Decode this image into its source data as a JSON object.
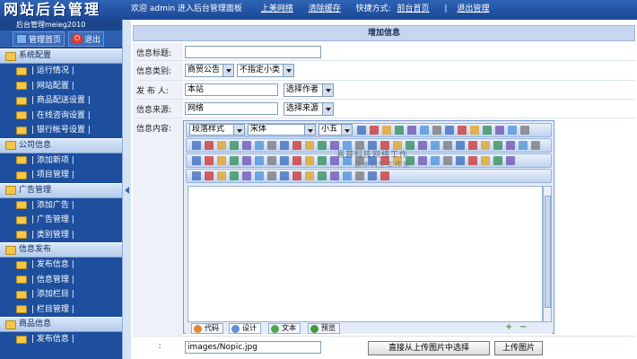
{
  "header": {
    "logo": "网站后台管理",
    "subtitle": "后台管理meieg2010",
    "welcome": "欢迎 admin 进入后台管理面板",
    "link_site": "上美网络",
    "link_cache": "清除缓存",
    "shortcut_prefix": "快捷方式:",
    "link_home": "前台首页",
    "sep": "|",
    "link_logout": "退出管理"
  },
  "sidebar": {
    "home_label": "管理首页",
    "exit_label": "退出",
    "groups": [
      {
        "title": "系统配置",
        "items": [
          "| 运行情况 |",
          "| 网站配置 |",
          "| 商品配送设置 |",
          "| 在线咨询设置 |",
          "| 银行帐号设置 |"
        ]
      },
      {
        "title": "公司信息",
        "items": [
          "| 添加新项 |",
          "| 项目管理 |"
        ]
      },
      {
        "title": "广告管理",
        "items": [
          "| 添加广告 |",
          "| 广告管理 |",
          "| 类别管理 |"
        ]
      },
      {
        "title": "信息发布",
        "items": [
          "| 发布信息 |",
          "| 信息管理 |",
          "| 添加栏目 |",
          "| 栏目管理 |"
        ]
      },
      {
        "title": "商品信息",
        "items": [
          "| 发布信息 |"
        ]
      }
    ]
  },
  "form": {
    "heading": "增加信息",
    "title_label": "信息标题:",
    "title_value": "",
    "category_label": "信息类别:",
    "category_selected": "商贸公告",
    "subcategory_selected": "不指定小类",
    "author_label": "发 布 人:",
    "author_value": "本站",
    "author_select": "选择作者",
    "source_label": "信息来源:",
    "source_value": "网络",
    "source_select": "选择来源",
    "content_label": "信息内容:",
    "image_label": ":",
    "image_value": "images/Nopic.jpg",
    "upload_select_button": "直接从上传图片中选择",
    "upload_button": "上传图片"
  },
  "editor": {
    "paragraph_style": "段落样式",
    "font": "宋体",
    "size": "小五",
    "watermark_line1": "易普科技网络工作",
    "watermark_line2": "蓝木时空工作室",
    "tabs": [
      "代码",
      "设计",
      "文本",
      "预览"
    ]
  },
  "colors": {
    "topbar": "#1b4895",
    "sidebar": "#1d4f9e",
    "group_header": "#c7d6ef",
    "form_header": "#c7d6ef"
  }
}
